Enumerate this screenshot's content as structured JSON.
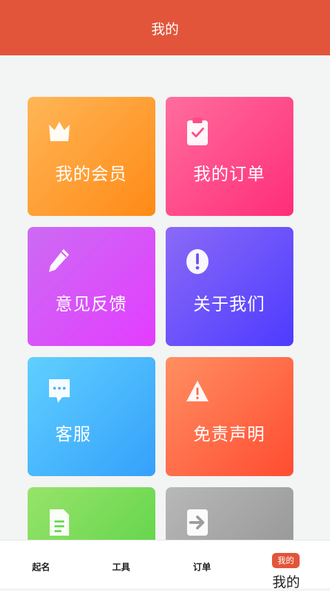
{
  "header": {
    "title": "我的"
  },
  "tiles": [
    {
      "label": "我的会员",
      "icon": "crown-icon"
    },
    {
      "label": "我的订单",
      "icon": "clipboard-check-icon"
    },
    {
      "label": "意见反馈",
      "icon": "pencil-icon"
    },
    {
      "label": "关于我们",
      "icon": "info-exclamation-icon"
    },
    {
      "label": "客服",
      "icon": "chat-bubble-icon"
    },
    {
      "label": "免责声明",
      "icon": "warning-icon"
    },
    {
      "label": "",
      "icon": "document-icon"
    },
    {
      "label": "",
      "icon": "logout-icon"
    }
  ],
  "tabbar": {
    "items": [
      {
        "label": "起名"
      },
      {
        "label": "工具"
      },
      {
        "label": "订单"
      },
      {
        "label": "我的",
        "badge": "我的"
      }
    ]
  }
}
